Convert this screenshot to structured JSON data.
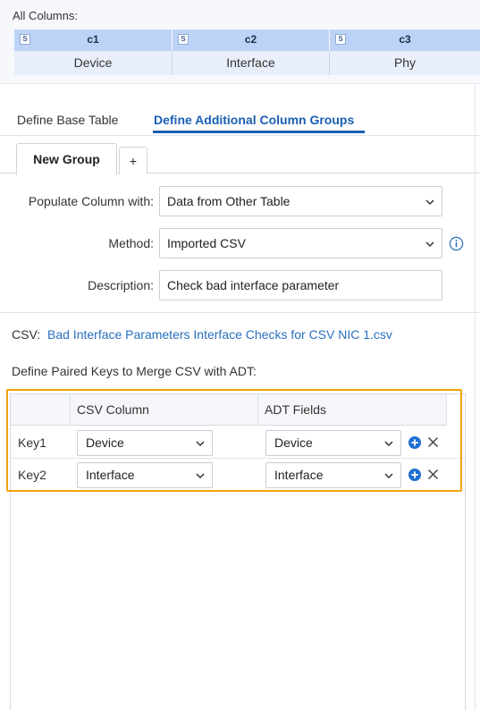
{
  "all_columns": {
    "title": "All Columns:",
    "columns": [
      {
        "type_badge": "S",
        "name": "c1",
        "value": "Device"
      },
      {
        "type_badge": "S",
        "name": "c2",
        "value": "Interface"
      },
      {
        "type_badge": "S",
        "name": "c3",
        "value": "Phy"
      }
    ]
  },
  "tabs": [
    {
      "label": "Define Base Table",
      "active": false
    },
    {
      "label": "Define Additional Column Groups",
      "active": true
    }
  ],
  "group_tabs": [
    {
      "label": "New Group",
      "active": true
    },
    {
      "label": "+",
      "active": false
    }
  ],
  "form": {
    "populate": {
      "label": "Populate Column with:",
      "value": "Data from Other Table"
    },
    "method": {
      "label": "Method:",
      "value": "Imported CSV",
      "info_icon": "info-icon"
    },
    "description": {
      "label": "Description:",
      "value": "Check bad interface parameter"
    }
  },
  "csv": {
    "label": "CSV:",
    "file": "Bad Interface Parameters Interface Checks for CSV NIC 1.csv"
  },
  "paired_keys": {
    "title": "Define Paired Keys to Merge CSV with ADT:",
    "headers": [
      "",
      "CSV Column",
      "ADT Fields"
    ],
    "rows": [
      {
        "key": "Key1",
        "csv_column": "Device",
        "adt_field": "Device"
      },
      {
        "key": "Key2",
        "csv_column": "Interface",
        "adt_field": "Interface"
      }
    ]
  },
  "colors": {
    "accent": "#1a5fb4",
    "link": "#2a6fbf",
    "highlight": "#f0a30a",
    "column_header": "#bcd3f7"
  }
}
